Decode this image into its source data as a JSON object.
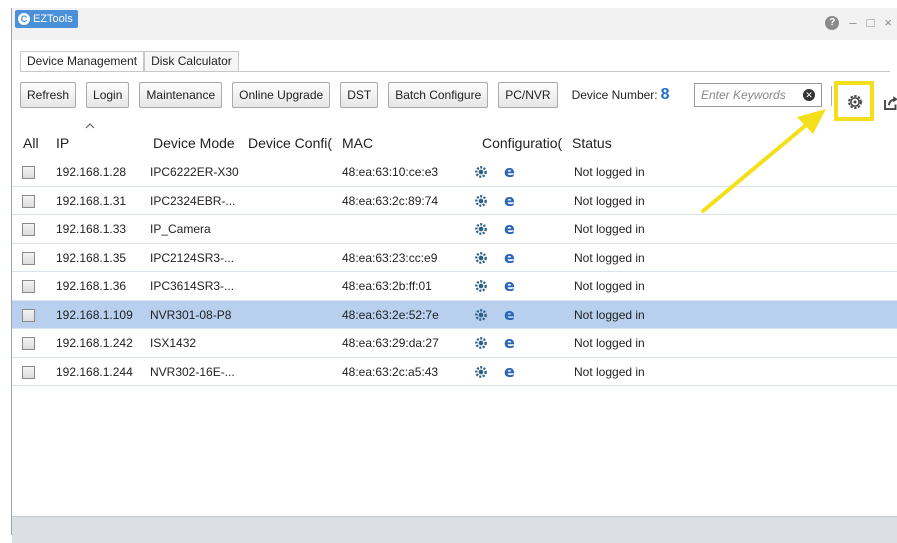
{
  "app": {
    "title": "EZTools",
    "logo_letter": "C"
  },
  "window_controls": {
    "help": "?",
    "minimize": "–",
    "maximize": "□",
    "close": "×"
  },
  "tabs": [
    {
      "label": "Device Management",
      "active": true
    },
    {
      "label": "Disk Calculator",
      "active": false
    }
  ],
  "toolbar": {
    "buttons": [
      "Refresh",
      "Login",
      "Maintenance",
      "Online Upgrade",
      "DST",
      "Batch Configure",
      "PC/NVR"
    ],
    "device_number_label": "Device Number:",
    "device_number": "8",
    "search_placeholder": "Enter Keywords"
  },
  "table": {
    "columns": [
      "All",
      "IP",
      "Device Mode",
      "Device Confi(",
      "MAC",
      "Configuratio(",
      "Status"
    ],
    "rows": [
      {
        "ip": "192.168.1.28",
        "model": "IPC6222ER-X30",
        "mac": "48:ea:63:10:ce:e3",
        "status": "Not logged in",
        "selected": false
      },
      {
        "ip": "192.168.1.31",
        "model": "IPC2324EBR-...",
        "mac": "48:ea:63:2c:89:74",
        "status": "Not logged in",
        "selected": false
      },
      {
        "ip": "192.168.1.33",
        "model": "IP_Camera",
        "mac": "",
        "status": "Not logged in",
        "selected": false
      },
      {
        "ip": "192.168.1.35",
        "model": "IPC2124SR3-...",
        "mac": "48:ea:63:23:cc:e9",
        "status": "Not logged in",
        "selected": false
      },
      {
        "ip": "192.168.1.36",
        "model": "IPC3614SR3-...",
        "mac": "48:ea:63:2b:ff:01",
        "status": "Not logged in",
        "selected": false
      },
      {
        "ip": "192.168.1.109",
        "model": "NVR301-08-P8",
        "mac": "48:ea:63:2e:52:7e",
        "status": "Not logged in",
        "selected": true
      },
      {
        "ip": "192.168.1.242",
        "model": "ISX1432",
        "mac": "48:ea:63:29:da:27",
        "status": "Not logged in",
        "selected": false
      },
      {
        "ip": "192.168.1.244",
        "model": "NVR302-16E-...",
        "mac": "48:ea:63:2c:a5:43",
        "status": "Not logged in",
        "selected": false
      }
    ]
  },
  "icons": {
    "settings": "gear-icon",
    "export": "export-icon",
    "row_config": "gear-icon",
    "row_web": "ie-icon"
  },
  "colors": {
    "accent": "#4a90d9",
    "device_number": "#1f6fd0",
    "selected_row": "#b8d0ee",
    "highlight": "#f4e01a"
  }
}
